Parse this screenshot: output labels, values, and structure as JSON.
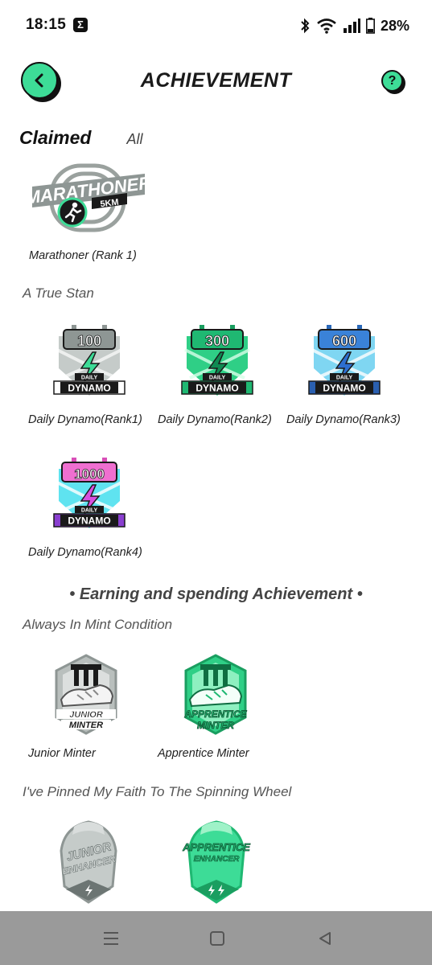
{
  "status_bar": {
    "time": "18:15",
    "app_icon_glyph": "Σ",
    "battery_percent": "28%",
    "icons": [
      "bluetooth-icon",
      "wifi-icon",
      "signal-icon",
      "battery-icon"
    ]
  },
  "header": {
    "title": "ACHIEVEMENT",
    "back_icon": "chevron-left-icon",
    "help_glyph": "?"
  },
  "tabs": {
    "active": "Claimed",
    "other": "All"
  },
  "groups": {
    "marathoner": {
      "badge_text": "MARATHONER",
      "badge_sub": "5KM",
      "label": "Marathoner (Rank 1)"
    },
    "true_stan": {
      "heading": "A True Stan",
      "badges": [
        {
          "number": "100",
          "label": "Daily Dynamo(Rank1)"
        },
        {
          "number": "300",
          "label": "Daily Dynamo(Rank2)"
        },
        {
          "number": "600",
          "label": "Daily Dynamo(Rank3)"
        },
        {
          "number": "1000",
          "label": "Daily Dynamo(Rank4)"
        }
      ],
      "badge_small_text": "DAILY",
      "badge_big_text": "DYNAMO"
    },
    "section_heading": "• Earning and spending Achievement •",
    "mint": {
      "heading": "Always In Mint Condition",
      "badges": [
        {
          "line1": "JUNIOR",
          "line2": "MINTER",
          "label": "Junior Minter"
        },
        {
          "line1": "APPRENTICE",
          "line2": "MINTER",
          "label": "Apprentice Minter"
        }
      ]
    },
    "wheel": {
      "heading": "I've Pinned My Faith To The Spinning Wheel",
      "badges": [
        {
          "line1": "JUNIOR",
          "line2": "ENHANCER"
        },
        {
          "line1": "APPRENTICE",
          "line2": "ENHANCER"
        }
      ]
    }
  },
  "colors": {
    "accent": "#3ddc97",
    "rank1": "#8e9694",
    "rank2": "#1fb872",
    "rank3": "#3a82d8",
    "rank4": "#ef6fd0",
    "nav_bar": "#9a9a9a"
  },
  "nav_bar": {
    "icons": [
      "menu-icon",
      "home-square-icon",
      "back-triangle-icon"
    ]
  }
}
